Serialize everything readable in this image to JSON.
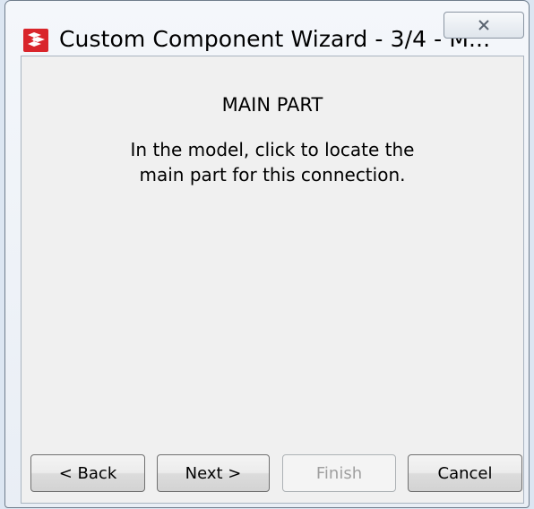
{
  "window": {
    "title": "Custom Component Wizard - 3/4 - M...",
    "icon": "tekla-app-icon",
    "close_icon": "close-icon"
  },
  "content": {
    "heading": "MAIN PART",
    "instruction_line1": "In the model, click to locate the",
    "instruction_line2": "main part for this connection."
  },
  "buttons": {
    "back": "< Back",
    "next": "Next >",
    "finish": "Finish",
    "cancel": "Cancel"
  },
  "colors": {
    "icon_red": "#d9252b",
    "client_background": "#f0f0f0",
    "disabled_text": "#a0a0a0"
  }
}
